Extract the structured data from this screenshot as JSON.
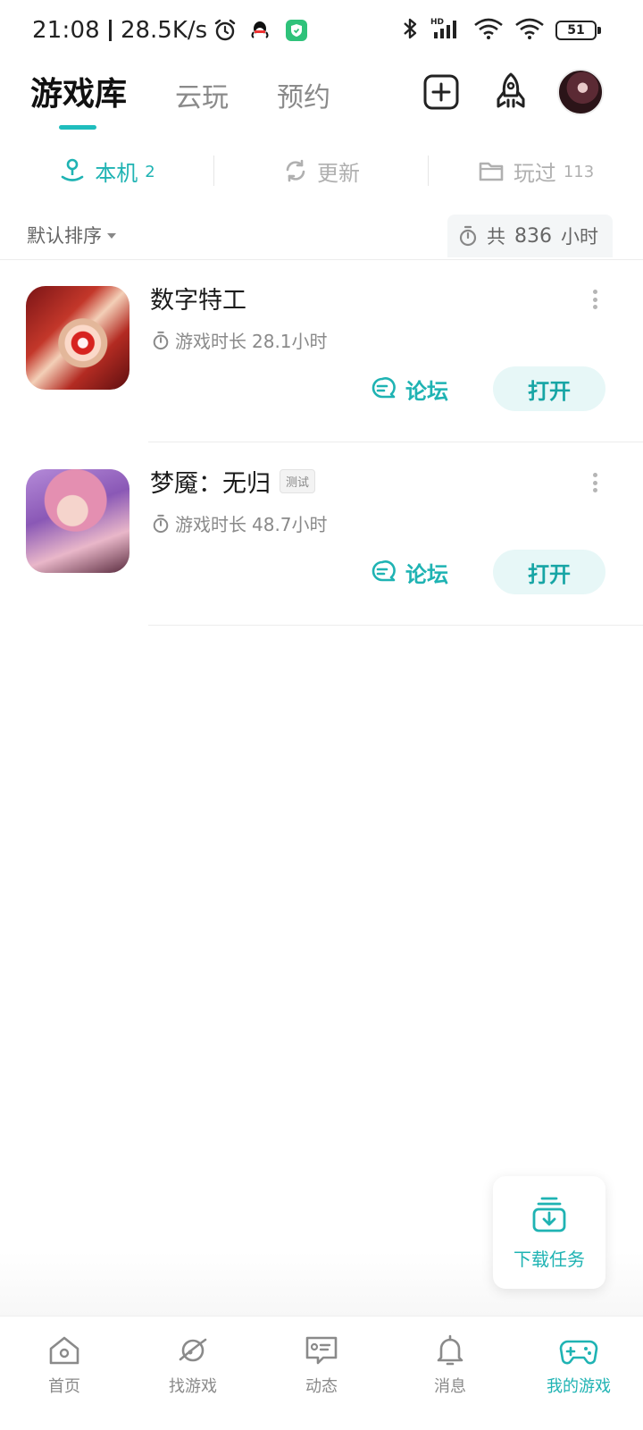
{
  "status_bar": {
    "time": "21:08",
    "speed": "28.5K/s",
    "battery": "51",
    "left_icons": [
      "alarm-icon",
      "qq-icon",
      "shield-app-icon"
    ],
    "right_icons": [
      "bluetooth-icon",
      "hd-signal-icon",
      "wifi-icon",
      "wifi-icon",
      "battery-icon"
    ]
  },
  "header": {
    "tabs": [
      "游戏库",
      "云玩",
      "预约"
    ],
    "active_tab": "游戏库",
    "actions": [
      "add-icon",
      "rocket-icon",
      "avatar"
    ]
  },
  "sub_tabs": [
    {
      "label": "本机",
      "count": "2",
      "icon": "joystick-icon"
    },
    {
      "label": "更新",
      "count": "",
      "icon": "refresh-icon"
    },
    {
      "label": "玩过",
      "count": "113",
      "icon": "folder-icon"
    }
  ],
  "sort": {
    "label": "默认排序",
    "total_prefix": "共",
    "total_hours": "836",
    "total_suffix": "小时"
  },
  "games": [
    {
      "title": "数字特工",
      "tag": "",
      "duration_label": "游戏时长",
      "duration": "28.1小时",
      "forum_label": "论坛",
      "open_label": "打开"
    },
    {
      "title": "梦魇：无归",
      "tag": "测试",
      "duration_label": "游戏时长",
      "duration": "48.7小时",
      "forum_label": "论坛",
      "open_label": "打开"
    }
  ],
  "download_task": {
    "label": "下载任务"
  },
  "bottom_nav": [
    {
      "label": "首页",
      "icon": "home-icon"
    },
    {
      "label": "找游戏",
      "icon": "planet-icon"
    },
    {
      "label": "动态",
      "icon": "chat-card-icon"
    },
    {
      "label": "消息",
      "icon": "bell-icon"
    },
    {
      "label": "我的游戏",
      "icon": "gamepad-icon"
    }
  ],
  "colors": {
    "accent": "#1fb3b3",
    "open_button_bg": "#e7f7f7",
    "muted_text": "#8a8a8a"
  }
}
